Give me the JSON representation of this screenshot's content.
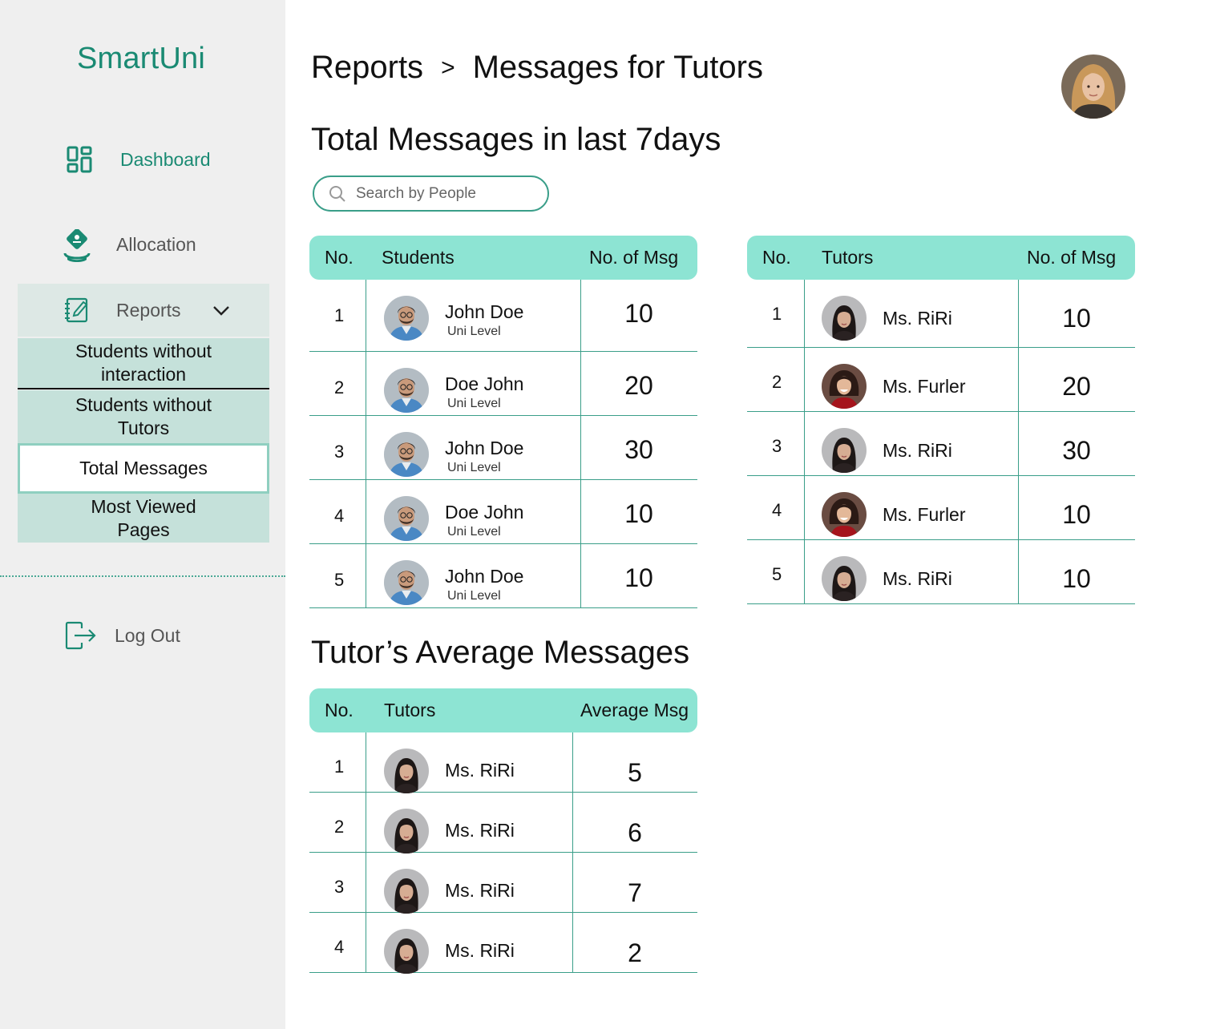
{
  "app": {
    "logo": "SmartUni"
  },
  "sidebar": {
    "items": [
      {
        "label": "Dashboard"
      },
      {
        "label": "Allocation"
      },
      {
        "label": "Reports"
      },
      {
        "label": "Log Out"
      }
    ],
    "submenu": [
      {
        "label": "Students without interaction"
      },
      {
        "label": "Students without Tutors"
      },
      {
        "label": "Total Messages"
      },
      {
        "label": "Most Viewed Pages"
      }
    ],
    "active_submenu": "Total Messages"
  },
  "header": {
    "breadcrumb": [
      "Reports",
      ">",
      "Messages for Tutors"
    ]
  },
  "section1": {
    "title": "Total Messages in last 7days",
    "search": {
      "placeholder": "Search by People",
      "value": ""
    }
  },
  "students_table": {
    "headers": [
      "No.",
      "Students",
      "No. of Msg"
    ],
    "rows": [
      {
        "no": "1",
        "name": "John Doe",
        "level": "Uni Level",
        "msgs": "10"
      },
      {
        "no": "2",
        "name": "Doe John",
        "level": "Uni Level",
        "msgs": "20"
      },
      {
        "no": "3",
        "name": "John Doe",
        "level": "Uni Level",
        "msgs": "30"
      },
      {
        "no": "4",
        "name": "Doe John",
        "level": "Uni Level",
        "msgs": "10"
      },
      {
        "no": "5",
        "name": "John Doe",
        "level": "Uni Level",
        "msgs": "10"
      }
    ]
  },
  "tutors_table": {
    "headers": [
      "No.",
      "Tutors",
      "No. of Msg"
    ],
    "rows": [
      {
        "no": "1",
        "name": "Ms. RiRi",
        "msgs": "10"
      },
      {
        "no": "2",
        "name": "Ms. Furler",
        "msgs": "20"
      },
      {
        "no": "3",
        "name": "Ms. RiRi",
        "msgs": "30"
      },
      {
        "no": "4",
        "name": "Ms. Furler",
        "msgs": "10"
      },
      {
        "no": "5",
        "name": "Ms. RiRi",
        "msgs": "10"
      }
    ]
  },
  "section2": {
    "title": "Tutor’s Average Messages"
  },
  "avg_table": {
    "headers": [
      "No.",
      "Tutors",
      "Average Msg"
    ],
    "rows": [
      {
        "no": "1",
        "name": "Ms. RiRi",
        "avg": "5"
      },
      {
        "no": "2",
        "name": "Ms. RiRi",
        "avg": "6"
      },
      {
        "no": "3",
        "name": "Ms. RiRi",
        "avg": "7"
      },
      {
        "no": "4",
        "name": "Ms. RiRi",
        "avg": "2"
      }
    ]
  },
  "colors": {
    "brand": "#1a8a73",
    "table_header": "#8de4d3",
    "submenu_bg": "#c5e1da",
    "sidebar_bg": "#efefef"
  },
  "icons": {
    "dashboard": "grid-icon",
    "allocation": "allocation-icon",
    "reports": "notebook-icon",
    "logout": "logout-icon",
    "search": "search-icon"
  }
}
